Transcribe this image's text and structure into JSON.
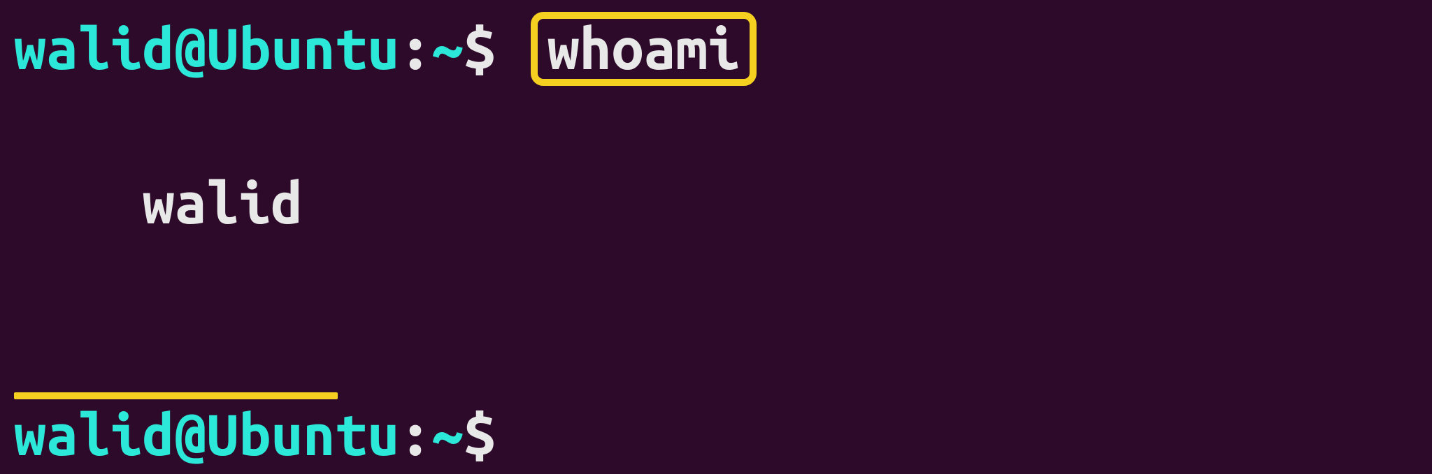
{
  "terminal": {
    "lines": [
      {
        "prompt": {
          "userHost": "walid@Ubuntu",
          "colon": ":",
          "path": "~",
          "symbol": "$"
        },
        "command": "whoami"
      },
      {
        "output": "walid"
      },
      {
        "prompt": {
          "userHost": "walid@Ubuntu",
          "colon": ":",
          "path": "~",
          "symbol": "$"
        },
        "command": ""
      }
    ]
  },
  "colors": {
    "background": "#2d0a2a",
    "promptUserHost": "#2ce8d8",
    "text": "#e8e8e8",
    "highlight": "#f5d020"
  }
}
